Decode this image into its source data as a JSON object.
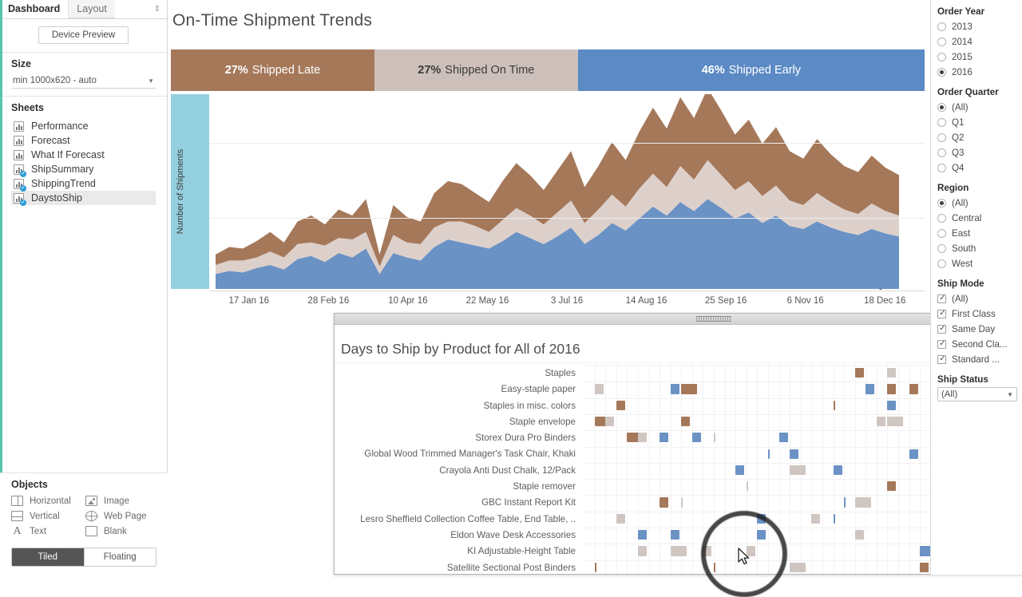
{
  "left_panel": {
    "tabs": [
      {
        "label": "Dashboard",
        "active": true
      },
      {
        "label": "Layout",
        "active": false
      }
    ],
    "tab_icon": "sort-icon",
    "device_preview_label": "Device Preview",
    "size": {
      "title": "Size",
      "value": "min 1000x620 - auto",
      "caret_icon": "chevron-down-icon"
    },
    "sheets": {
      "title": "Sheets",
      "items": [
        {
          "label": "Performance",
          "used": false,
          "selected": false
        },
        {
          "label": "Forecast",
          "used": false,
          "selected": false
        },
        {
          "label": "What If Forecast",
          "used": false,
          "selected": false
        },
        {
          "label": "ShipSummary",
          "used": true,
          "selected": false
        },
        {
          "label": "ShippingTrend",
          "used": true,
          "selected": false
        },
        {
          "label": "DaystoShip",
          "used": true,
          "selected": true
        }
      ]
    },
    "objects": {
      "title": "Objects",
      "items": [
        {
          "label": "Horizontal",
          "icon": "horizontal-container-icon"
        },
        {
          "label": "Image",
          "icon": "image-icon"
        },
        {
          "label": "Vertical",
          "icon": "vertical-container-icon"
        },
        {
          "label": "Web Page",
          "icon": "globe-icon"
        },
        {
          "label": "Text",
          "icon": "text-icon"
        },
        {
          "label": "Blank",
          "icon": "blank-icon"
        }
      ]
    },
    "layout_toggle": [
      {
        "label": "Tiled",
        "on": true
      },
      {
        "label": "Floating",
        "on": false
      }
    ]
  },
  "dashboard": {
    "title": "On-Time Shipment Trends",
    "kpis": [
      {
        "value": "27%",
        "label": "Shipped Late",
        "color": "#a5785a",
        "text_color": "#ffffff",
        "width_pct": 27
      },
      {
        "value": "27%",
        "label": "Shipped On Time",
        "color": "#cdc0bb",
        "text_color": "#3a3a3a",
        "width_pct": 27
      },
      {
        "value": "46%",
        "label": "Shipped Early",
        "color": "#5b8ac4",
        "text_color": "#ffffff",
        "width_pct": 46
      }
    ]
  },
  "chart_data": {
    "type": "area",
    "title": "On-Time Shipment Trends",
    "xlabel": "",
    "ylabel": "Number of Shipments",
    "ylim": [
      0,
      130
    ],
    "y_ticks": [
      0,
      50,
      100
    ],
    "grid": true,
    "stacked": true,
    "legend_position": "none",
    "x_tick_labels": [
      "17 Jan 16",
      "28 Feb 16",
      "10 Apr 16",
      "22 May 16",
      "3 Jul 16",
      "14 Aug 16",
      "25 Sep 16",
      "6 Nov 16",
      "18 Dec 16"
    ],
    "axis_highlighted": true,
    "series": [
      {
        "name": "Shipped Early",
        "color": "#6b92c4",
        "values": [
          10,
          12,
          11,
          14,
          16,
          13,
          20,
          22,
          18,
          24,
          21,
          27,
          10,
          24,
          21,
          19,
          28,
          33,
          31,
          29,
          27,
          32,
          38,
          34,
          30,
          35,
          41,
          30,
          36,
          44,
          39,
          47,
          55,
          49,
          58,
          52,
          60,
          54,
          47,
          51,
          44,
          49,
          42,
          40,
          45,
          41,
          38,
          36,
          40,
          37,
          35
        ]
      },
      {
        "name": "Shipped On Time",
        "color": "#ddd0cb",
        "values": [
          6,
          7,
          8,
          7,
          9,
          8,
          10,
          9,
          11,
          10,
          12,
          11,
          5,
          12,
          10,
          11,
          13,
          12,
          14,
          13,
          11,
          14,
          16,
          15,
          13,
          16,
          18,
          14,
          17,
          19,
          16,
          20,
          22,
          19,
          24,
          21,
          26,
          22,
          19,
          21,
          18,
          20,
          17,
          16,
          19,
          17,
          15,
          14,
          17,
          15,
          14
        ]
      },
      {
        "name": "Shipped Late",
        "color": "#a5785a",
        "values": [
          7,
          9,
          8,
          11,
          13,
          10,
          15,
          18,
          14,
          19,
          16,
          22,
          8,
          20,
          17,
          15,
          23,
          27,
          25,
          22,
          20,
          26,
          30,
          27,
          23,
          28,
          33,
          24,
          29,
          35,
          31,
          38,
          44,
          39,
          46,
          41,
          48,
          43,
          37,
          41,
          35,
          39,
          33,
          31,
          36,
          32,
          29,
          28,
          32,
          29,
          27
        ]
      }
    ]
  },
  "floating_panel": {
    "title": "Days to Ship by Product for All of 2016",
    "titlebar_controls": [
      {
        "icon": "caret-down-icon",
        "name": "more-options-icon"
      },
      {
        "icon": "filter-icon",
        "name": "filter-icon"
      },
      {
        "icon": "close-icon",
        "name": "close-icon"
      }
    ],
    "expand_icon": "external-link-icon",
    "grip_icon": "drag-grip-icon",
    "rows": [
      "Staples",
      "Easy-staple paper",
      "Staples in misc. colors",
      "Staple envelope",
      "Storex Dura Pro Binders",
      "Global Wood Trimmed Manager's Task Chair, Khaki",
      "Crayola Anti Dust Chalk, 12/Pack",
      "Staple remover",
      "GBC Instant Report Kit",
      "Lesro Sheffield Collection Coffee Table, End Table, ..",
      "Eldon Wave Desk Accessories",
      "KI Adjustable-Height Table",
      "Satellite Sectional Post Binders"
    ],
    "mark_colors": {
      "early": "#6b92c4",
      "on_time": "#cfc6c2",
      "late": "#a5785a"
    },
    "scrollbar": {
      "up_icon": "chevron-up-icon",
      "down_icon": "chevron-down-icon",
      "thumb": "scroll-thumb"
    }
  },
  "filters": {
    "groups": [
      {
        "title": "Order Year",
        "type": "radio",
        "options": [
          {
            "label": "2013",
            "selected": false
          },
          {
            "label": "2014",
            "selected": false
          },
          {
            "label": "2015",
            "selected": false
          },
          {
            "label": "2016",
            "selected": true
          }
        ]
      },
      {
        "title": "Order Quarter",
        "type": "radio",
        "options": [
          {
            "label": "(All)",
            "selected": true
          },
          {
            "label": "Q1",
            "selected": false
          },
          {
            "label": "Q2",
            "selected": false
          },
          {
            "label": "Q3",
            "selected": false
          },
          {
            "label": "Q4",
            "selected": false
          }
        ]
      },
      {
        "title": "Region",
        "type": "radio",
        "options": [
          {
            "label": "(All)",
            "selected": true
          },
          {
            "label": "Central",
            "selected": false
          },
          {
            "label": "East",
            "selected": false
          },
          {
            "label": "South",
            "selected": false
          },
          {
            "label": "West",
            "selected": false
          }
        ]
      },
      {
        "title": "Ship Mode",
        "type": "checkbox",
        "options": [
          {
            "label": "(All)",
            "selected": true
          },
          {
            "label": "First Class",
            "selected": true
          },
          {
            "label": "Same Day",
            "selected": true
          },
          {
            "label": "Second Cla...",
            "selected": true
          },
          {
            "label": "Standard ...",
            "selected": true
          }
        ]
      },
      {
        "title": "Ship Status",
        "type": "select",
        "value": "(All)",
        "caret_icon": "chevron-down-icon"
      }
    ]
  },
  "cursor": {
    "icon": "arrow-cursor",
    "highlight": "click-ring"
  }
}
